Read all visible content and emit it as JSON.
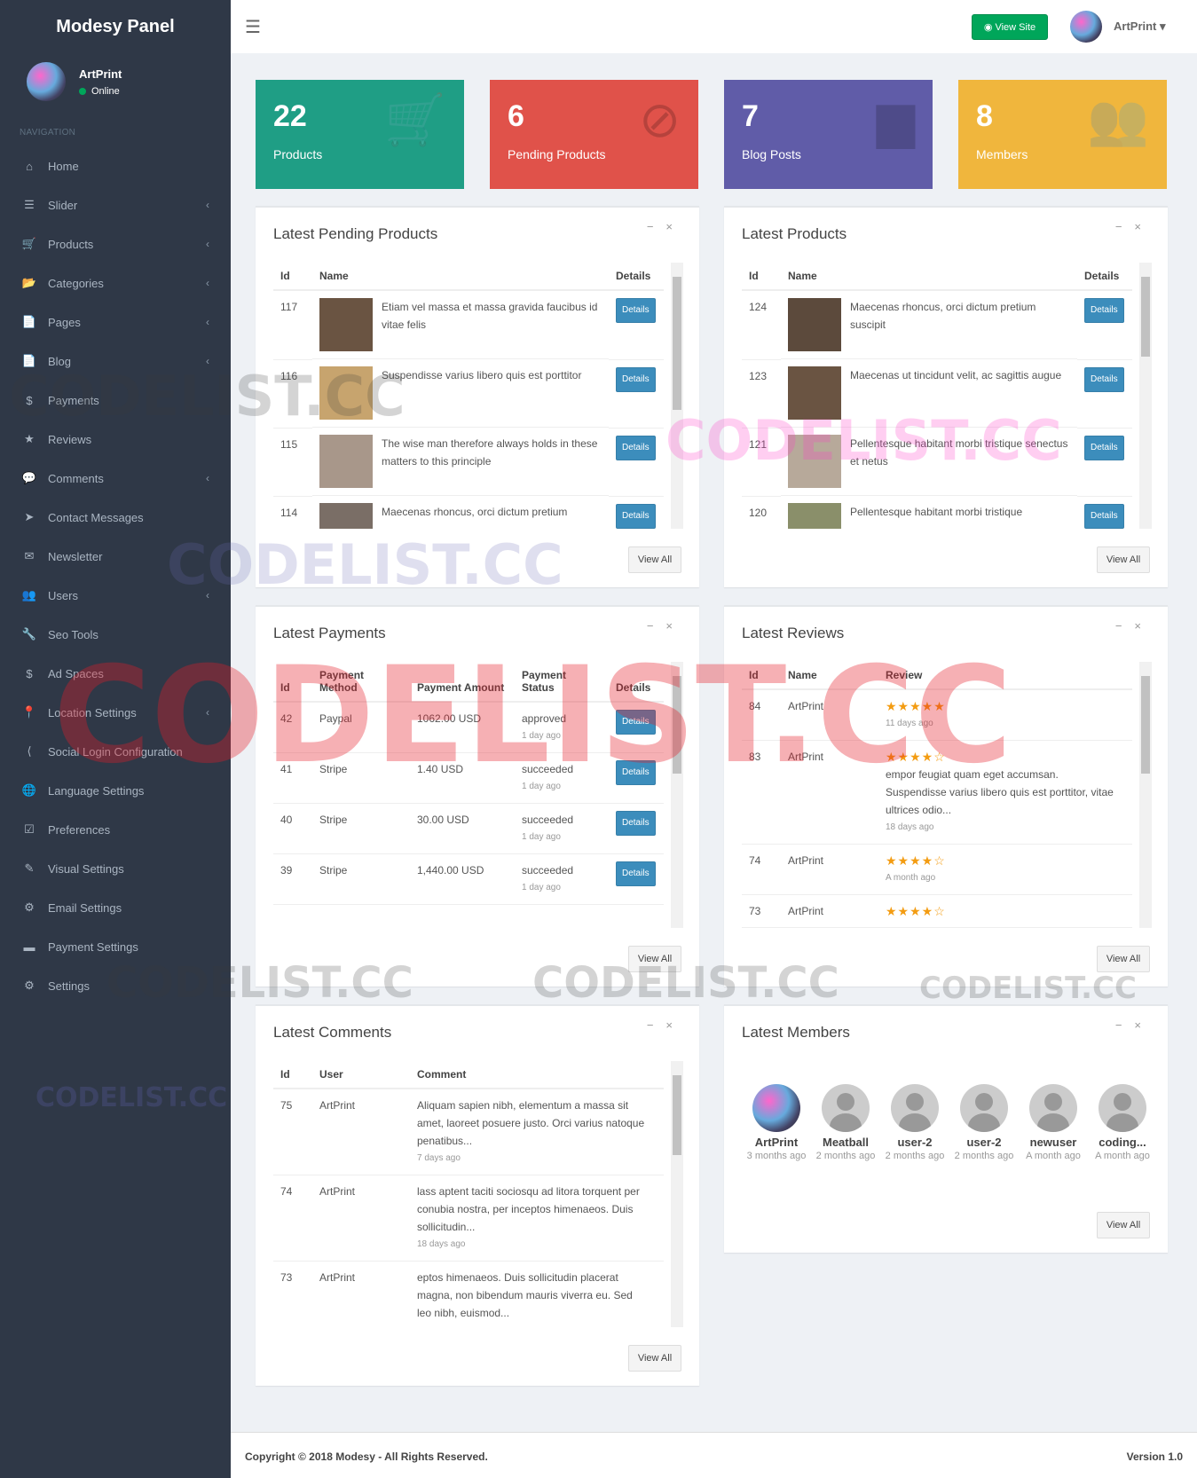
{
  "brand": "Modesy Panel",
  "user": {
    "name": "ArtPrint",
    "status": "Online"
  },
  "nav": {
    "heading": "NAVIGATION",
    "items": [
      {
        "label": "Home",
        "icon": "⌂",
        "arrow": false
      },
      {
        "label": "Slider",
        "icon": "☰",
        "arrow": true
      },
      {
        "label": "Products",
        "icon": "🛒",
        "arrow": true
      },
      {
        "label": "Categories",
        "icon": "📂",
        "arrow": true
      },
      {
        "label": "Pages",
        "icon": "📄",
        "arrow": true
      },
      {
        "label": "Blog",
        "icon": "📄",
        "arrow": true
      },
      {
        "label": "Payments",
        "icon": "$",
        "arrow": false
      },
      {
        "label": "Reviews",
        "icon": "★",
        "arrow": false
      },
      {
        "label": "Comments",
        "icon": "💬",
        "arrow": true
      },
      {
        "label": "Contact Messages",
        "icon": "➤",
        "arrow": false
      },
      {
        "label": "Newsletter",
        "icon": "✉",
        "arrow": false
      },
      {
        "label": "Users",
        "icon": "👥",
        "arrow": true
      },
      {
        "label": "Seo Tools",
        "icon": "🔧",
        "arrow": false
      },
      {
        "label": "Ad Spaces",
        "icon": "$",
        "arrow": false
      },
      {
        "label": "Location Settings",
        "icon": "📍",
        "arrow": true
      },
      {
        "label": "Social Login Configuration",
        "icon": "⟨",
        "arrow": false
      },
      {
        "label": "Language Settings",
        "icon": "🌐",
        "arrow": false
      },
      {
        "label": "Preferences",
        "icon": "☑",
        "arrow": false
      },
      {
        "label": "Visual Settings",
        "icon": "✎",
        "arrow": false
      },
      {
        "label": "Email Settings",
        "icon": "⚙",
        "arrow": false
      },
      {
        "label": "Payment Settings",
        "icon": "▬",
        "arrow": false
      },
      {
        "label": "Settings",
        "icon": "⚙",
        "arrow": false
      }
    ]
  },
  "topbar": {
    "view_site": "View Site",
    "user": "ArtPrint"
  },
  "stats": [
    {
      "num": "22",
      "label": "Products",
      "color": "#1f9e85",
      "icon": "🛒"
    },
    {
      "num": "6",
      "label": "Pending Products",
      "color": "#e0524a",
      "icon": "⊘"
    },
    {
      "num": "7",
      "label": "Blog Posts",
      "color": "#605ca8",
      "icon": "▆"
    },
    {
      "num": "8",
      "label": "Members",
      "color": "#f0b63d",
      "icon": "👥"
    }
  ],
  "pending": {
    "title": "Latest Pending Products",
    "cols": [
      "Id",
      "Name",
      "Details"
    ],
    "rows": [
      {
        "id": "117",
        "name": "Etiam vel massa et massa gravida faucibus id vitae felis",
        "img": "#6a5442"
      },
      {
        "id": "116",
        "name": "Suspendisse varius libero quis est porttitor",
        "img": "#c7a46e"
      },
      {
        "id": "115",
        "name": "The wise man therefore always holds in these matters to this principle",
        "img": "#a8978a"
      },
      {
        "id": "114",
        "name": "Maecenas rhoncus, orci dictum pretium",
        "img": "#7a6e66"
      }
    ]
  },
  "latest_products": {
    "title": "Latest Products",
    "cols": [
      "Id",
      "Name",
      "Details"
    ],
    "rows": [
      {
        "id": "124",
        "name": "Maecenas rhoncus, orci dictum pretium suscipit",
        "img": "#5c4a3c"
      },
      {
        "id": "123",
        "name": "Maecenas ut tincidunt velit, ac sagittis augue",
        "img": "#6a5442"
      },
      {
        "id": "121",
        "name": "Pellentesque habitant morbi tristique senectus et netus",
        "img": "#b7a99a"
      },
      {
        "id": "120",
        "name": "Pellentesque habitant morbi tristique",
        "img": "#8a8f6a"
      }
    ]
  },
  "payments": {
    "title": "Latest Payments",
    "cols": [
      "Id",
      "Payment Method",
      "Payment Amount",
      "Payment Status",
      "Details"
    ],
    "rows": [
      {
        "id": "42",
        "method": "Paypal",
        "amount": "1062.00 USD",
        "status": "approved",
        "ago": "1 day ago"
      },
      {
        "id": "41",
        "method": "Stripe",
        "amount": "1.40 USD",
        "status": "succeeded",
        "ago": "1 day ago"
      },
      {
        "id": "40",
        "method": "Stripe",
        "amount": "30.00 USD",
        "status": "succeeded",
        "ago": "1 day ago"
      },
      {
        "id": "39",
        "method": "Stripe",
        "amount": "1,440.00 USD",
        "status": "succeeded",
        "ago": "1 day ago"
      }
    ]
  },
  "reviews": {
    "title": "Latest Reviews",
    "cols": [
      "Id",
      "Name",
      "Review"
    ],
    "rows": [
      {
        "id": "84",
        "name": "ArtPrint",
        "stars": "★★★★★",
        "text": "",
        "ago": "11 days ago"
      },
      {
        "id": "83",
        "name": "ArtPrint",
        "stars": "★★★★☆",
        "text": "empor feugiat quam eget accumsan. Suspendisse varius libero quis est porttitor, vitae ultrices odio...",
        "ago": "18 days ago"
      },
      {
        "id": "74",
        "name": "ArtPrint",
        "stars": "★★★★☆",
        "text": "",
        "ago": "A month ago"
      },
      {
        "id": "73",
        "name": "ArtPrint",
        "stars": "★★★★☆",
        "text": "",
        "ago": ""
      }
    ]
  },
  "comments": {
    "title": "Latest Comments",
    "cols": [
      "Id",
      "User",
      "Comment"
    ],
    "rows": [
      {
        "id": "75",
        "user": "ArtPrint",
        "text": "Aliquam sapien nibh, elementum a massa sit amet, laoreet posuere justo. Orci varius natoque penatibus...",
        "ago": "7 days ago"
      },
      {
        "id": "74",
        "user": "ArtPrint",
        "text": "lass aptent taciti sociosqu ad litora torquent per conubia nostra, per inceptos himenaeos. Duis sollicitudin...",
        "ago": "18 days ago"
      },
      {
        "id": "73",
        "user": "ArtPrint",
        "text": "eptos himenaeos. Duis sollicitudin placerat magna, non bibendum mauris viverra eu. Sed leo nibh, euismod...",
        "ago": ""
      }
    ]
  },
  "members": {
    "title": "Latest Members",
    "list": [
      {
        "name": "ArtPrint",
        "ago": "3 months ago"
      },
      {
        "name": "Meatball",
        "ago": "2 months ago"
      },
      {
        "name": "user-2",
        "ago": "2 months ago"
      },
      {
        "name": "user-2",
        "ago": "2 months ago"
      },
      {
        "name": "newuser",
        "ago": "A month ago"
      },
      {
        "name": "coding...",
        "ago": "A month ago"
      }
    ]
  },
  "view_all": "View All",
  "details": "Details",
  "footer": {
    "copyright": "Copyright © 2018 Modesy - All Rights Reserved.",
    "version": "Version 1.0"
  },
  "watermark": "CODELIST.CC"
}
